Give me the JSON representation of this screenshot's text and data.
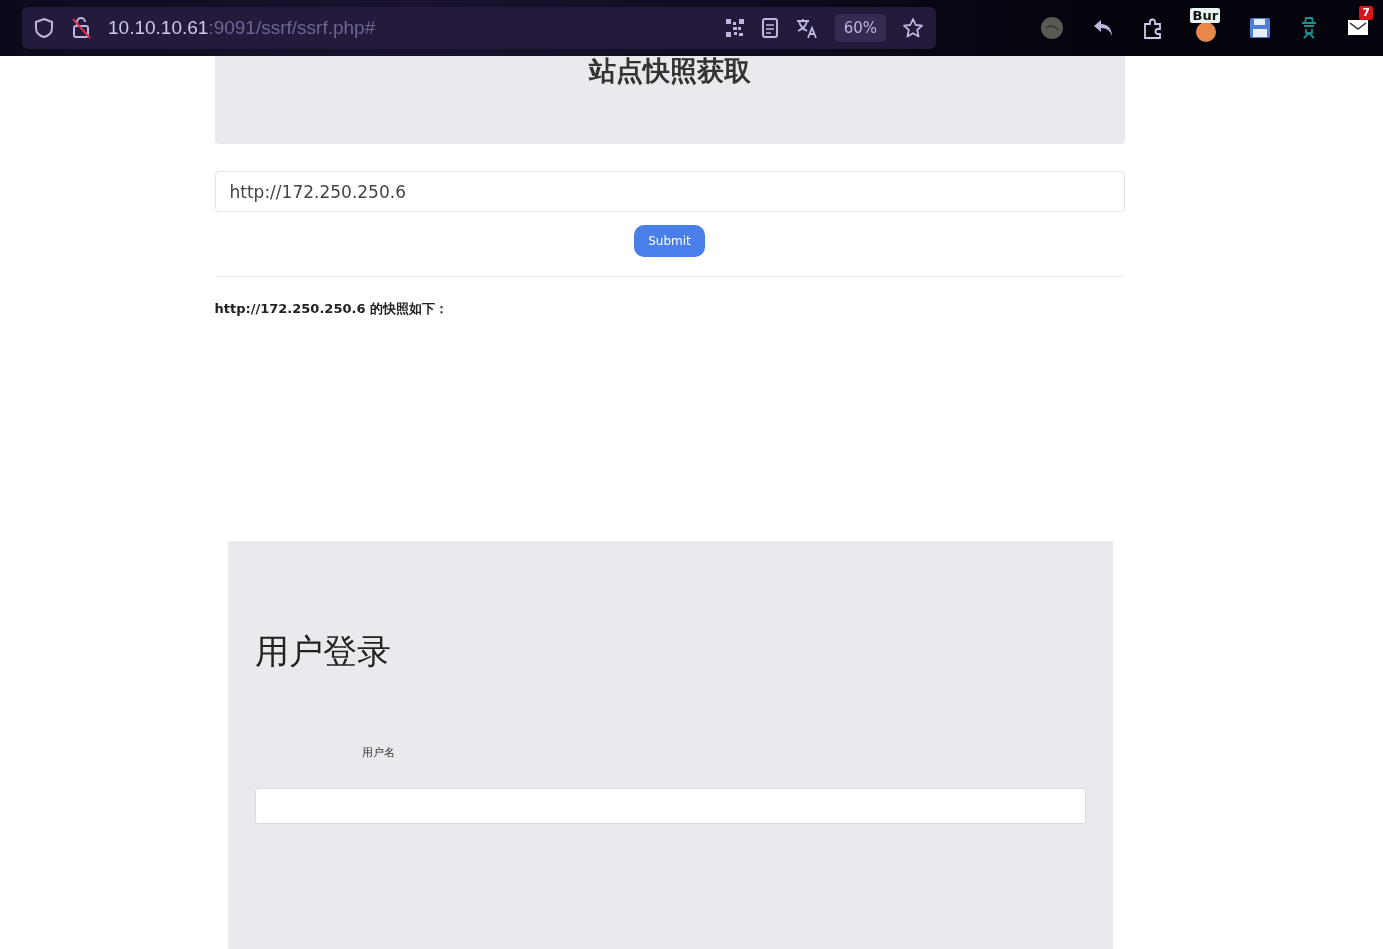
{
  "browser": {
    "url_host": "10.10.10.61",
    "url_rest": ":9091/ssrf/ssrf.php#",
    "zoom": "60%",
    "extensions": [
      {
        "kind": "burp",
        "badge": "Bur"
      },
      {
        "kind": "mail",
        "badge": "7"
      }
    ]
  },
  "page": {
    "title": "站点快照获取",
    "url_field": {
      "value": "http://172.250.250.6"
    },
    "submit": "Submit",
    "result_caption": "http://172.250.250.6 的快照如下："
  },
  "snapshot": {
    "title": "用户登录",
    "username_label": "用户名"
  }
}
